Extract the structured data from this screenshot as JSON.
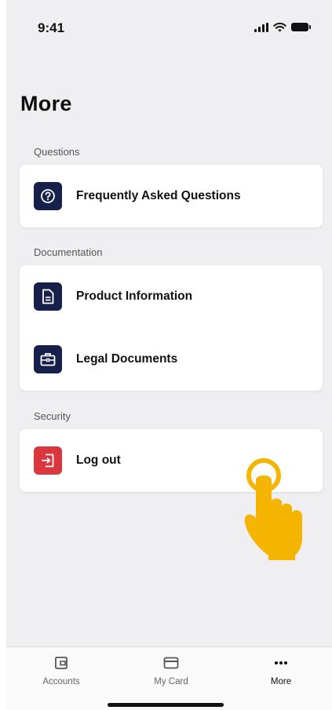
{
  "status_bar": {
    "time": "9:41"
  },
  "page": {
    "title": "More"
  },
  "sections": [
    {
      "label": "Questions",
      "items": [
        {
          "label": "Frequently Asked Questions",
          "icon": "question-circle-icon"
        }
      ]
    },
    {
      "label": "Documentation",
      "items": [
        {
          "label": "Product Information",
          "icon": "document-icon"
        },
        {
          "label": "Legal Documents",
          "icon": "briefcase-icon"
        }
      ]
    },
    {
      "label": "Security",
      "items": [
        {
          "label": "Log out",
          "icon": "logout-icon"
        }
      ]
    }
  ],
  "tabbar": {
    "accounts": "Accounts",
    "card": "My Card",
    "more": "More"
  },
  "colors": {
    "icon_bg": "#16204a",
    "logout_bg": "#d9363e",
    "pointer": "#f5b400"
  }
}
